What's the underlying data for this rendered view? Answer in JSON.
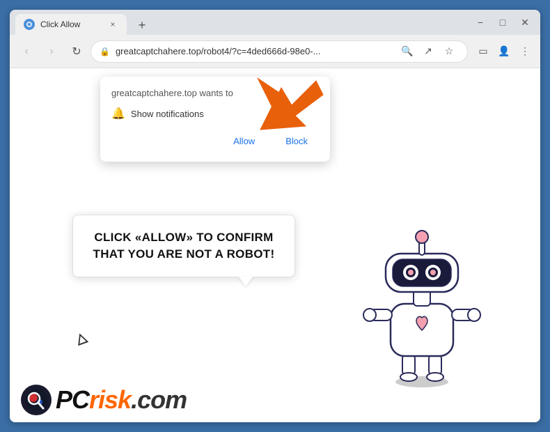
{
  "window": {
    "title": "Click Allow",
    "url": "greatcaptchahere.top/robot4/?c=4ded666d-98e0-...",
    "favicon": "🌐"
  },
  "tabs": [
    {
      "label": "Click Allow",
      "active": true
    }
  ],
  "nav": {
    "back_label": "‹",
    "forward_label": "›",
    "refresh_label": "↻"
  },
  "toolbar": {
    "search_icon": "🔍",
    "share_icon": "↗",
    "bookmark_icon": "☆",
    "sidebar_icon": "▭",
    "profile_icon": "👤",
    "menu_icon": "⋮",
    "new_tab": "+",
    "minimize": "−",
    "maximize": "□",
    "close": "✕"
  },
  "notification_popup": {
    "header": "greatcaptchahere.top wants to",
    "notification_label": "Show notifications",
    "allow_btn": "Allow",
    "block_btn": "Block",
    "close_btn": "×"
  },
  "speech_bubble": {
    "text": "CLICK «ALLOW» TO CONFIRM THAT YOU ARE NOT A ROBOT!"
  },
  "pcrisk": {
    "text_pc": "PC",
    "text_risk": "risk",
    "text_domain": ".com"
  }
}
